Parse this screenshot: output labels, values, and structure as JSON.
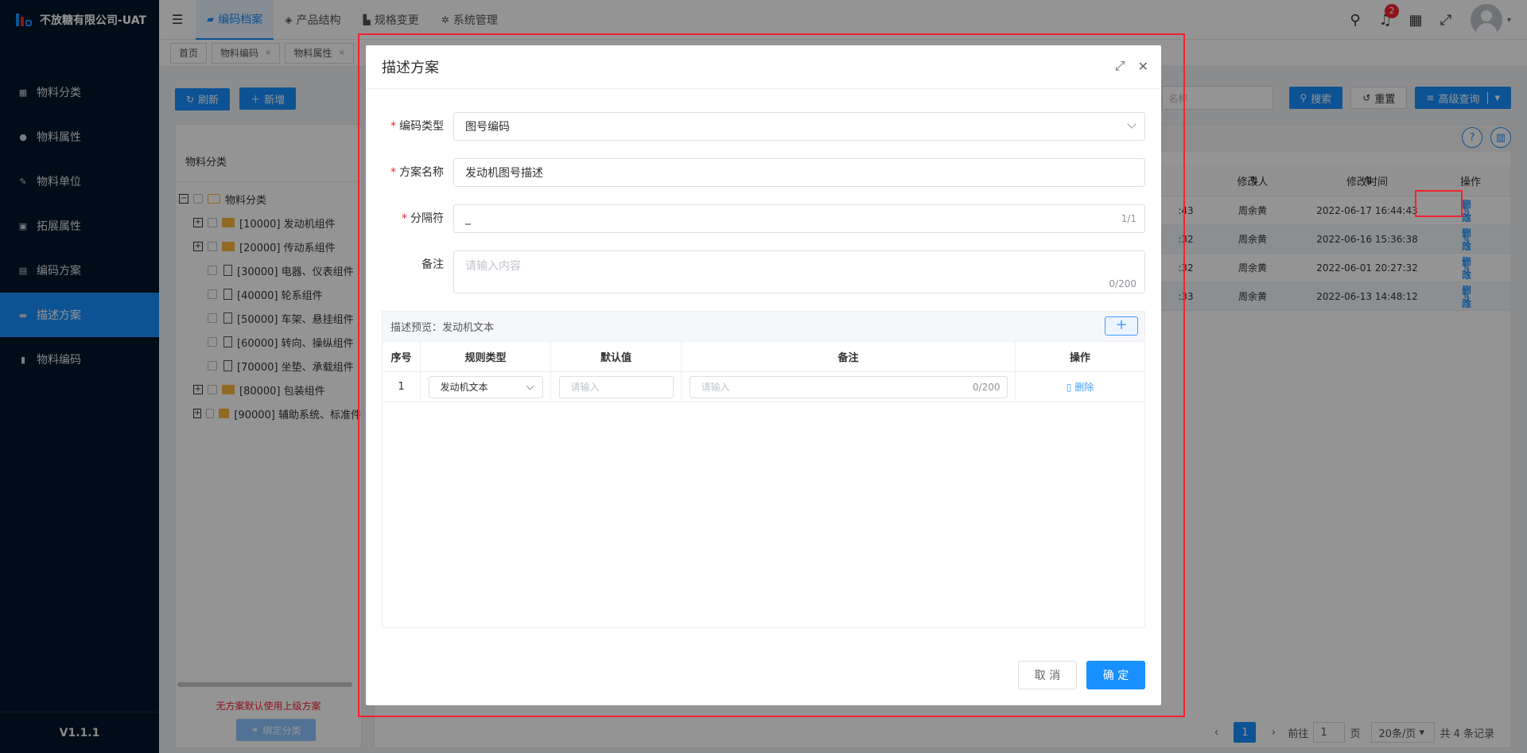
{
  "app": {
    "title": "不放糖有限公司-UAT",
    "version": "V1.1.1"
  },
  "sidebar": {
    "items": [
      {
        "label": "物料分类",
        "icon": "grid-icon"
      },
      {
        "label": "物料属性",
        "icon": "info-icon"
      },
      {
        "label": "物料单位",
        "icon": "wrench-icon"
      },
      {
        "label": "拓展属性",
        "icon": "image-icon"
      },
      {
        "label": "编码方案",
        "icon": "copy-icon"
      },
      {
        "label": "描述方案",
        "icon": "book-icon",
        "active": true
      },
      {
        "label": "物料编码",
        "icon": "file-icon"
      }
    ]
  },
  "topnav": {
    "tabs": [
      {
        "label": "编码档案",
        "active": true
      },
      {
        "label": "产品结构"
      },
      {
        "label": "规格变更"
      },
      {
        "label": "系统管理"
      }
    ],
    "notification_count": "2"
  },
  "tags": [
    {
      "label": "首页"
    },
    {
      "label": "物料编码"
    },
    {
      "label": "物料属性"
    }
  ],
  "toolbar": {
    "refresh": "刷新",
    "add": "新增",
    "search_placeholder": "名称",
    "search": "搜索",
    "reset": "重置",
    "advanced": "高级查询"
  },
  "tree": {
    "header": "物料分类",
    "root": "物料分类",
    "nodes": [
      {
        "label": "[10000] 发动机组件",
        "type": "folder"
      },
      {
        "label": "[20000] 传动系组件",
        "type": "folder"
      },
      {
        "label": "[30000] 电器、仪表组件",
        "type": "doc"
      },
      {
        "label": "[40000] 轮系组件",
        "type": "doc"
      },
      {
        "label": "[50000] 车架、悬挂组件",
        "type": "doc"
      },
      {
        "label": "[60000] 转向、操纵组件",
        "type": "doc"
      },
      {
        "label": "[70000] 坐垫、承载组件",
        "type": "doc"
      },
      {
        "label": "[80000] 包装组件",
        "type": "folder"
      },
      {
        "label": "[90000] 辅助系统、标准件",
        "type": "folder"
      }
    ],
    "note": "无方案默认使用上级方案",
    "bind_button": "绑定分类"
  },
  "grid": {
    "headers": {
      "modifier": "修改人",
      "modified_time": "修改时间",
      "actions": "操作"
    },
    "rows": [
      {
        "prefix": ":43",
        "modifier": "周余黄",
        "time": "2022-06-17 16:44:43"
      },
      {
        "prefix": ":32",
        "modifier": "周余黄",
        "time": "2022-06-16 15:36:38"
      },
      {
        "prefix": ":32",
        "modifier": "周余黄",
        "time": "2022-06-01 20:27:32"
      },
      {
        "prefix": ":33",
        "modifier": "周余黄",
        "time": "2022-06-13 14:48:12"
      }
    ],
    "edit": "修改",
    "delete": "删除"
  },
  "pager": {
    "current": "1",
    "goto_label": "前往",
    "goto_value": "1",
    "page_unit": "页",
    "page_size": "20条/页",
    "total": "共 4 条记录"
  },
  "dialog": {
    "title": "描述方案",
    "fields": {
      "code_type_label": "编码类型",
      "code_type_value": "图号编码",
      "scheme_name_label": "方案名称",
      "scheme_name_value": "发动机图号描述",
      "separator_label": "分隔符",
      "separator_value": "_",
      "separator_count": "1/1",
      "remark_label": "备注",
      "remark_placeholder": "请输入内容",
      "remark_count": "0/200"
    },
    "preview_label": "描述预览：",
    "preview_value": "发动机文本",
    "add_symbol": "+",
    "rule_table": {
      "headers": [
        "序号",
        "规则类型",
        "默认值",
        "备注",
        "操作"
      ],
      "rows": [
        {
          "index": "1",
          "rule_type": "发动机文本",
          "default_placeholder": "请输入",
          "remark_placeholder": "请输入",
          "remark_count": "0/200",
          "delete": "删除"
        }
      ]
    },
    "cancel": "取 消",
    "confirm": "确 定"
  }
}
